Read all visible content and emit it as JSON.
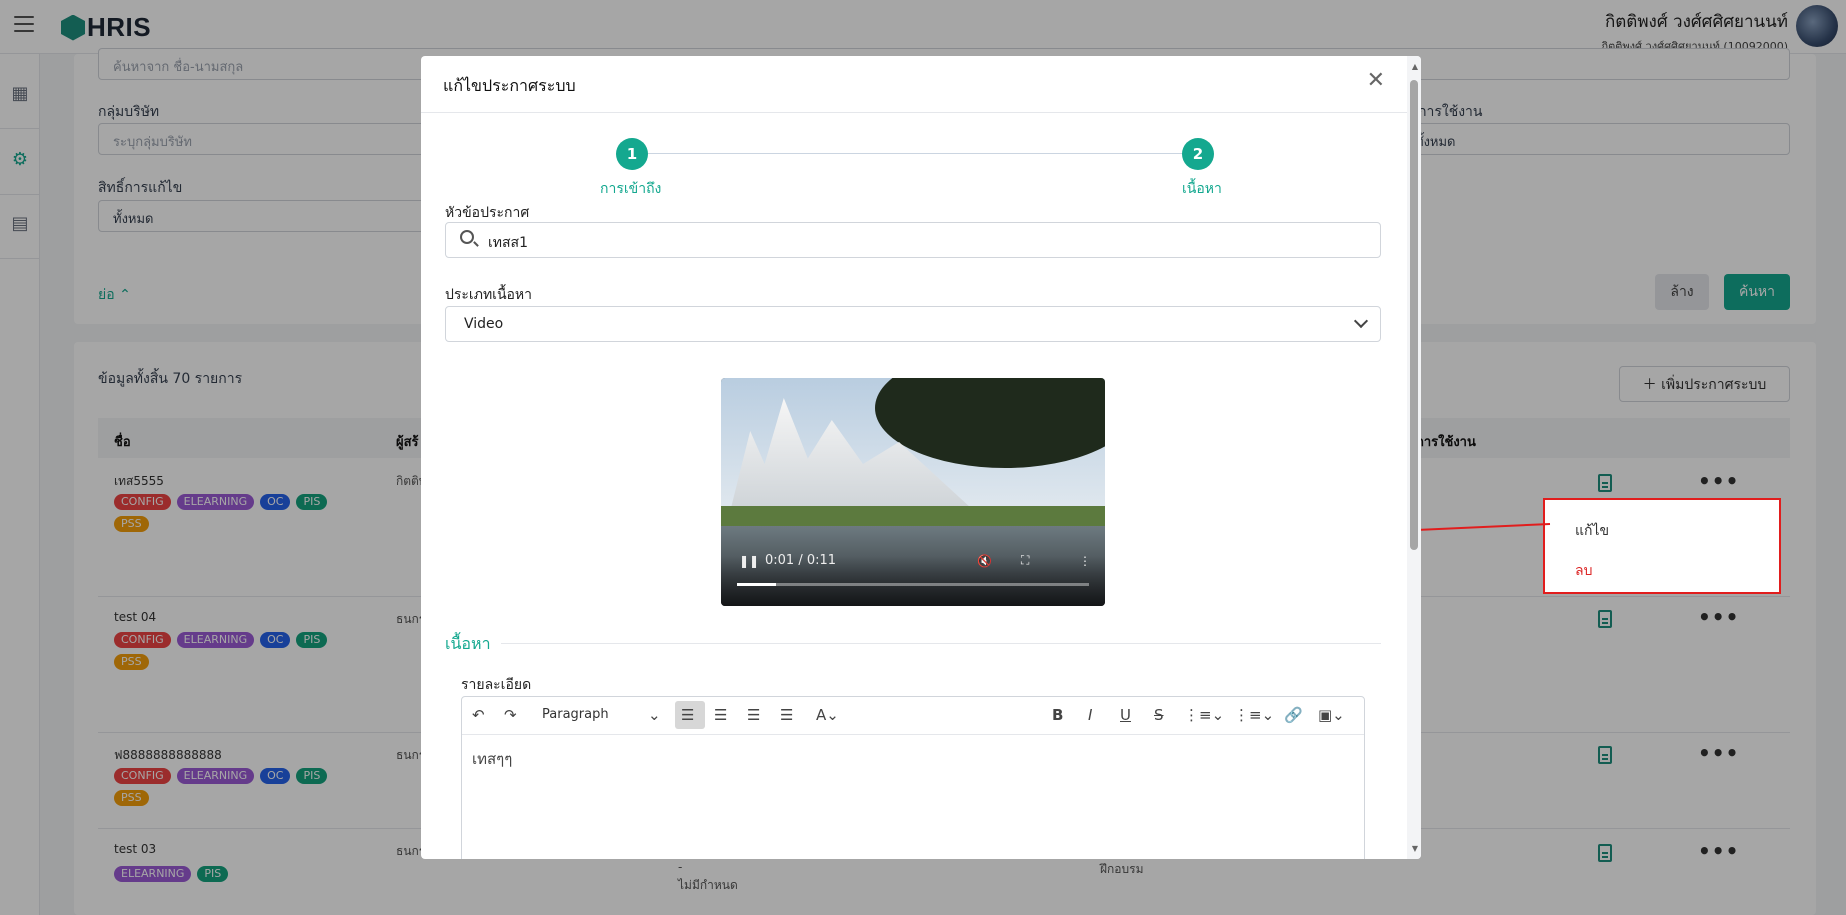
{
  "app": {
    "logo": "HRIS"
  },
  "user": {
    "name": "กิตติพงศ์ วงศ์ศศิศยานนท์",
    "sub": "กิตติพงศ์ วงศ์ศศิศยานนท์ (10092000)"
  },
  "filters": {
    "search_placeholder": "ค้นหาจาก ชื่อ-นามสกุล",
    "company_group_label": "กลุ่มบริษัท",
    "company_group_placeholder": "ระบุกลุ่มบริษัท",
    "status_label": "การใช้งาน",
    "status_value": "ทั้งหมด",
    "edit_right_label": "สิทธิ์การแก้ไข",
    "edit_right_value": "ทั้งหมด",
    "collapse": "ย่อ",
    "clear_btn": "ล้าง",
    "search_btn": "ค้นหา"
  },
  "list": {
    "total": "ข้อมูลทั้งสิ้น 70 รายการ",
    "add_btn": "เพิ่มประกาศระบบ",
    "col_name": "ชื่อ",
    "col_creator": "ผู้สร้",
    "col_status": "การใช้งาน",
    "rows": [
      {
        "name": "เทส5555",
        "creator": "กิตติพ",
        "tags": [
          "CONFIG",
          "ELEARNING",
          "OC",
          "PIS",
          "PSS"
        ]
      },
      {
        "name": "test 04",
        "creator": "ธนกร",
        "tags": [
          "CONFIG",
          "ELEARNING",
          "OC",
          "PIS",
          "PSS"
        ]
      },
      {
        "name": "ฟ8888888888888",
        "creator": "ธนกร",
        "tags": [
          "CONFIG",
          "ELEARNING",
          "OC",
          "PIS",
          "PSS"
        ]
      },
      {
        "name": "test 03",
        "creator": "ธนกร",
        "tags": [
          "ELEARNING",
          "PIS"
        ],
        "extra1": "-",
        "extra2": "ไม่มีกำหนด",
        "extra3": "ฝึกอบรม"
      }
    ]
  },
  "context_menu": {
    "edit": "แก้ไข",
    "delete": "ลบ"
  },
  "modal": {
    "title": "แก้ไขประกาศระบบ",
    "step1": "การเข้าถึง",
    "step2": "เนื้อหา",
    "step1_num": "1",
    "step2_num": "2",
    "topic_label": "หัวข้อประกาศ",
    "topic_value": "เทสส1",
    "type_label": "ประเภทเนื้อหา",
    "type_value": "Video",
    "video_time": "0:01 / 0:11",
    "video_progress": 0.11,
    "section_title": "เนื้อหา",
    "detail_label": "รายละเอียด",
    "paragraph": "Paragraph",
    "editor_text": "เทสๆๆ"
  }
}
